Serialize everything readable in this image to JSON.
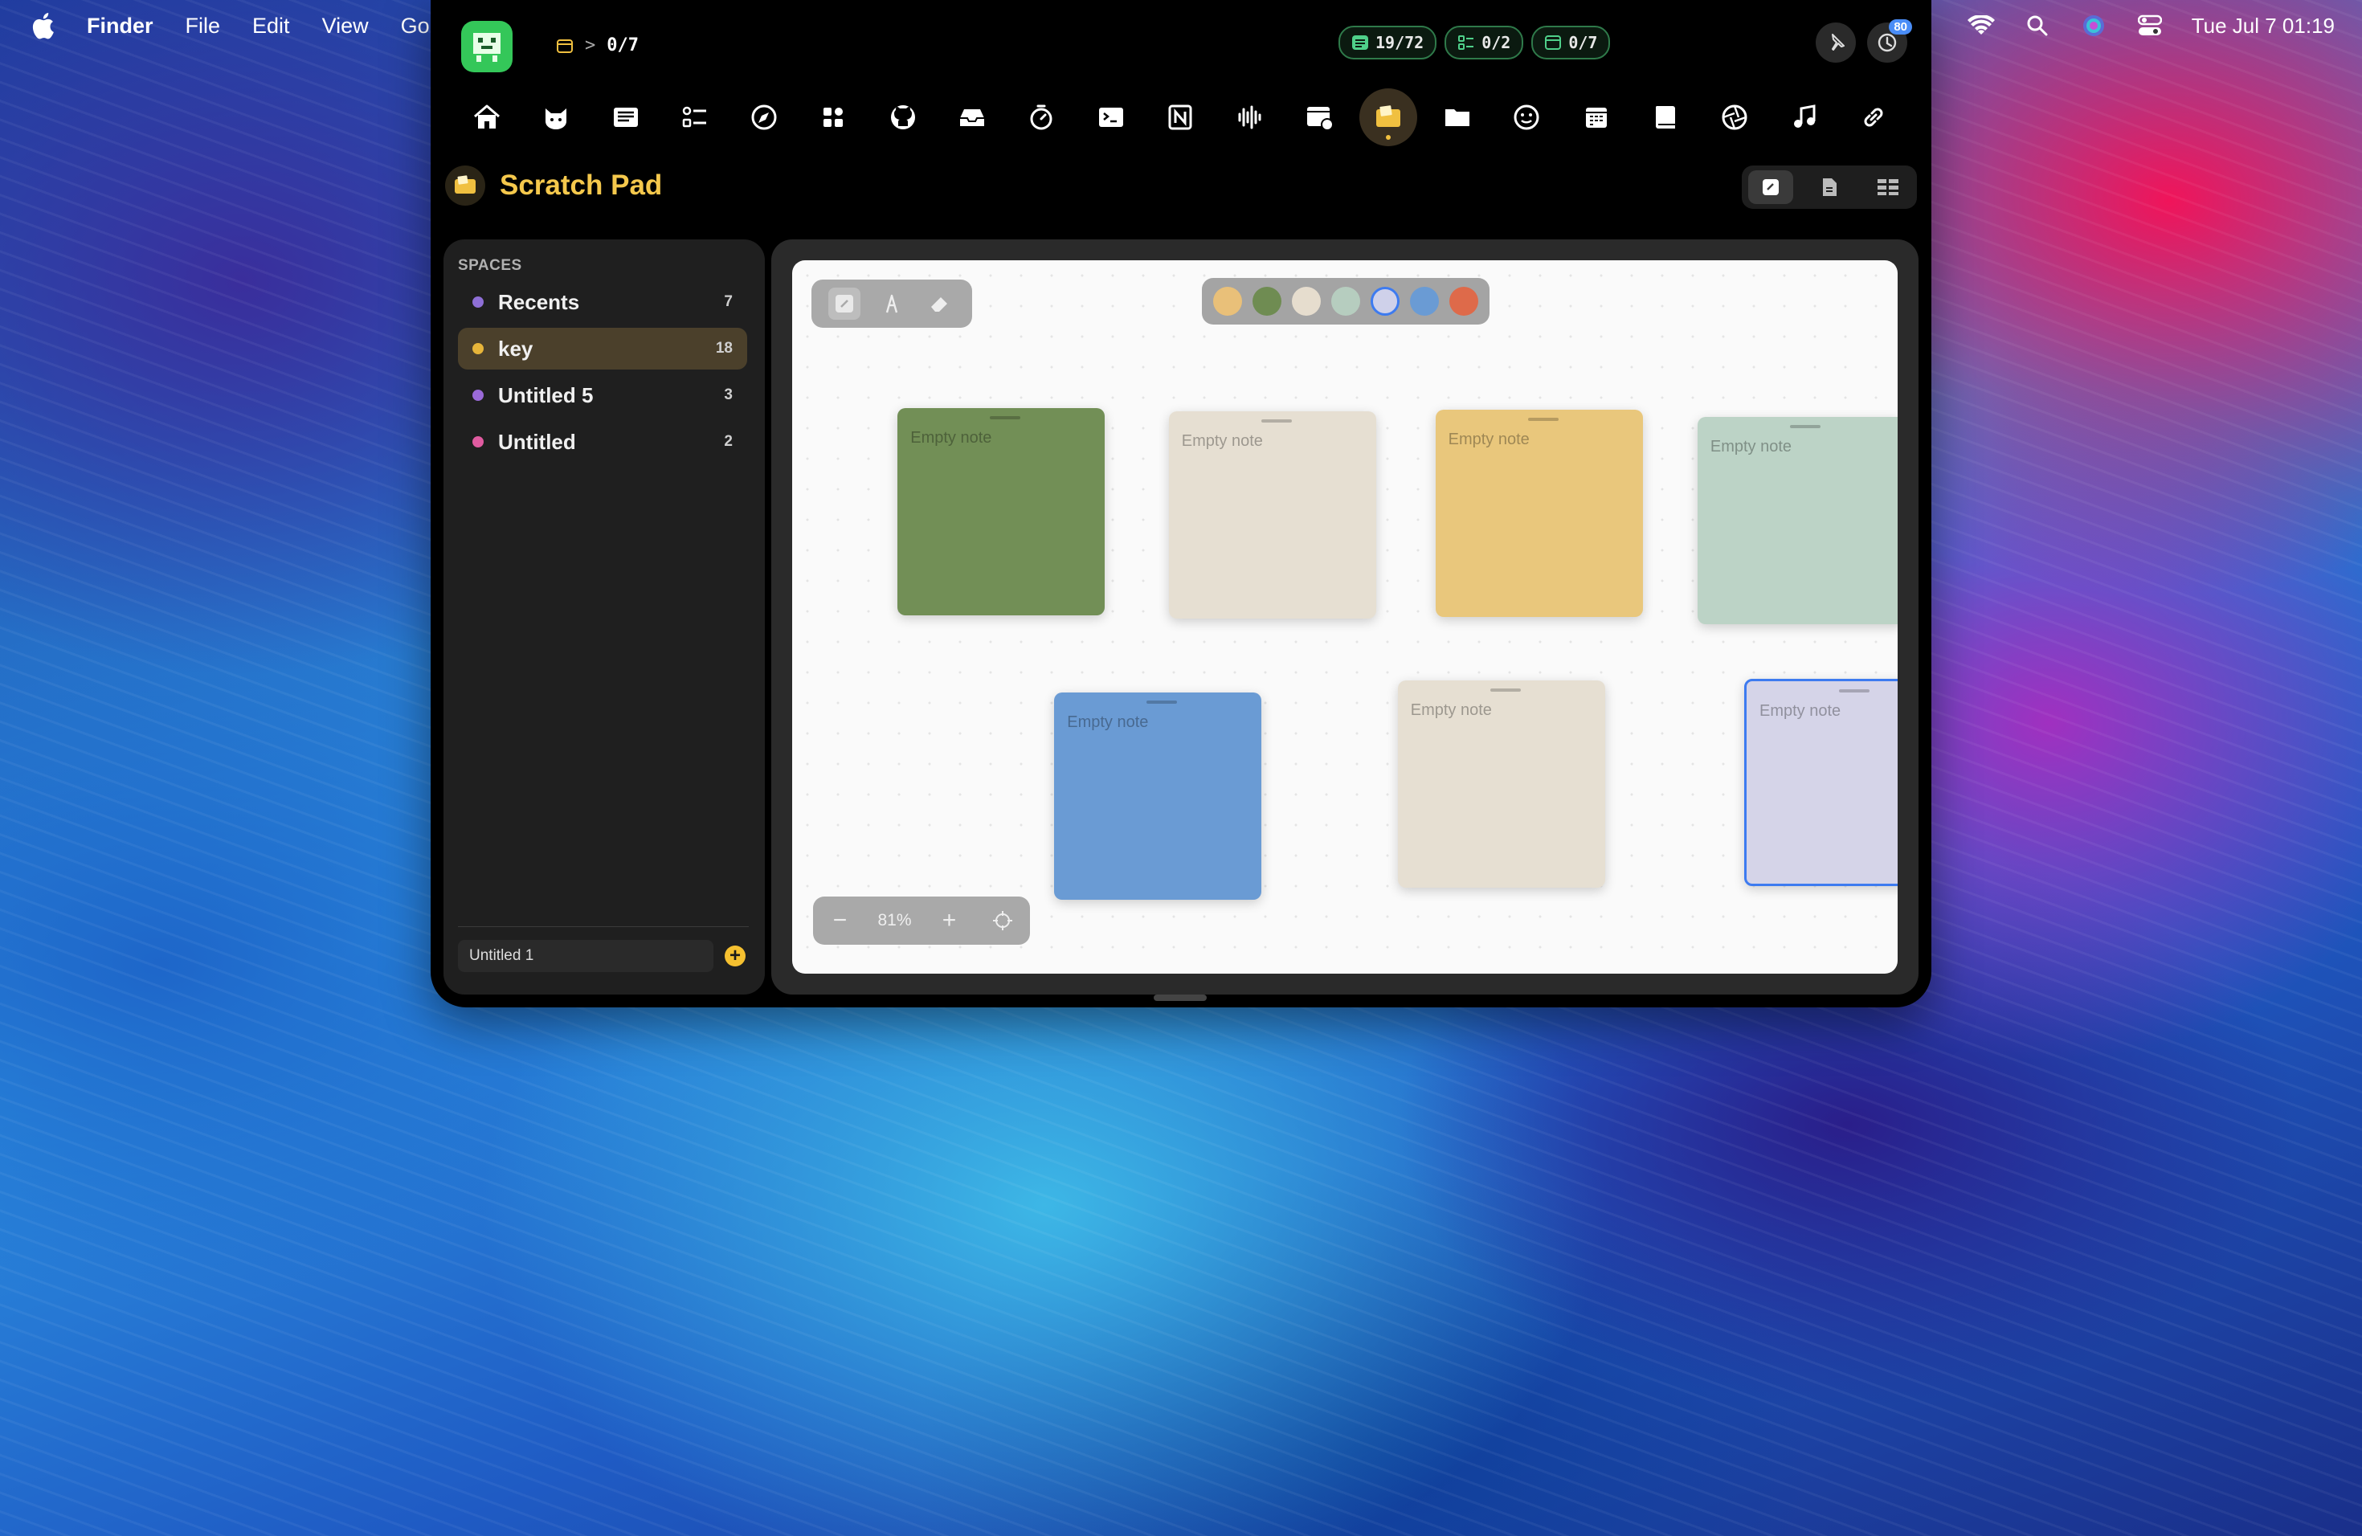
{
  "menubar": {
    "app_name": "Finder",
    "menus": [
      "File",
      "Edit",
      "View",
      "Go"
    ],
    "datetime": "Tue Jul 7  01:19"
  },
  "app": {
    "breadcrumb_sep": ">",
    "breadcrumb": "0/7",
    "counters": [
      {
        "value": "19/72",
        "icon": "list-icon",
        "color": "#4fd08a"
      },
      {
        "value": "0/2",
        "icon": "checklist-icon",
        "color": "#4fd08a"
      },
      {
        "value": "0/7",
        "icon": "calendar-icon",
        "color": "#4fd08a"
      }
    ],
    "history_badge": "80",
    "toolbar_icons": [
      "home-icon",
      "cat-icon",
      "news-icon",
      "checklist-icon",
      "compass-icon",
      "widgets-icon",
      "github-icon",
      "inbox-icon",
      "timer-icon",
      "terminal-icon",
      "notion-icon",
      "audio-waveform-icon",
      "calendar-badge-icon",
      "scratch-pad-icon",
      "folder-icon",
      "smiley-icon",
      "calendar-icon",
      "book-icon",
      "aperture-icon",
      "music-note-icon",
      "link-icon"
    ],
    "active_toolbar_icon": "scratch-pad-icon"
  },
  "page": {
    "title": "Scratch Pad"
  },
  "sidebar": {
    "header": "SPACES",
    "items": [
      {
        "label": "Recents",
        "count": "7",
        "color": "#8e6fd6",
        "active": false
      },
      {
        "label": "key",
        "count": "18",
        "color": "#e7b53a",
        "active": true
      },
      {
        "label": "Untitled 5",
        "count": "3",
        "color": "#9a6ad8",
        "active": false
      },
      {
        "label": "Untitled",
        "count": "2",
        "color": "#e05ba0",
        "active": false
      }
    ],
    "new_space_value": "Untitled 1"
  },
  "canvas": {
    "palette": [
      "#e9c079",
      "#6f8c52",
      "#e6ddce",
      "#b6cdbf",
      "#cfd1ea",
      "#6a9bd4",
      "#de6a4a"
    ],
    "selected_swatch": 4,
    "zoom": "81%",
    "notes": [
      {
        "text": "Empty note",
        "color": "#728f56"
      },
      {
        "text": "Empty note",
        "color": "#e6dfd2"
      },
      {
        "text": "Empty note",
        "color": "#e9c77c"
      },
      {
        "text": "Empty note",
        "color": "#bcd3c6"
      },
      {
        "text": "Empty note",
        "color": "#6a9bd4"
      },
      {
        "text": "Empty note",
        "color": "#e6dfd2"
      },
      {
        "text": "Empty note",
        "color": "#d5d4e8"
      }
    ]
  }
}
